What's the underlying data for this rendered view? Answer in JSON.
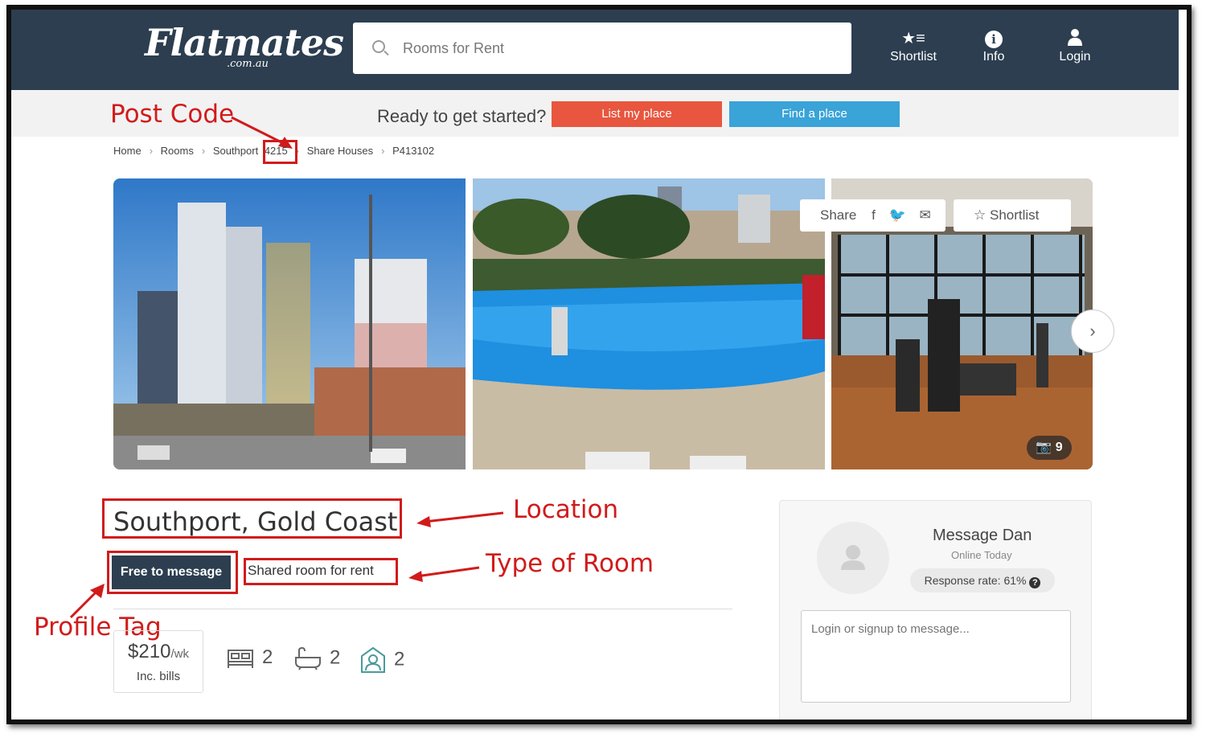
{
  "header": {
    "logo_text": "Flatmates",
    "logo_sub": ".com.au",
    "search_placeholder": "Rooms for Rent",
    "nav": [
      {
        "label": "Shortlist",
        "icon": "shortlist-star-icon"
      },
      {
        "label": "Info",
        "icon": "info-icon"
      },
      {
        "label": "Login",
        "icon": "user-icon"
      }
    ]
  },
  "cta": {
    "text": "Ready to get started?",
    "list_label": "List my place",
    "find_label": "Find a place"
  },
  "breadcrumb": [
    "Home",
    "Rooms",
    "Southport",
    "4215",
    "Share Houses",
    "P413102"
  ],
  "gallery": {
    "share_label": "Share",
    "shortlist_label": "Shortlist",
    "photo_count": "9"
  },
  "listing": {
    "title": "Southport, Gold Coast",
    "tag_profile": "Free to message",
    "tag_room": "Shared room for rent",
    "price": "$210",
    "price_unit": "/wk",
    "price_note": "Inc. bills",
    "bedrooms": "2",
    "bathrooms": "2",
    "flatmates": "2"
  },
  "message": {
    "name": "Message Dan",
    "status": "Online Today",
    "response_rate": "Response rate: 61%",
    "input_placeholder": "Login or signup to message..."
  },
  "annotations": {
    "post_code": "Post Code",
    "location": "Location",
    "type_of_room": "Type of Room",
    "profile_tag": "Profile Tag"
  },
  "colors": {
    "header_bg": "#2c3e50",
    "list_btn": "#e8563f",
    "find_btn": "#3aa3d8",
    "annotation": "#d11b1b"
  }
}
